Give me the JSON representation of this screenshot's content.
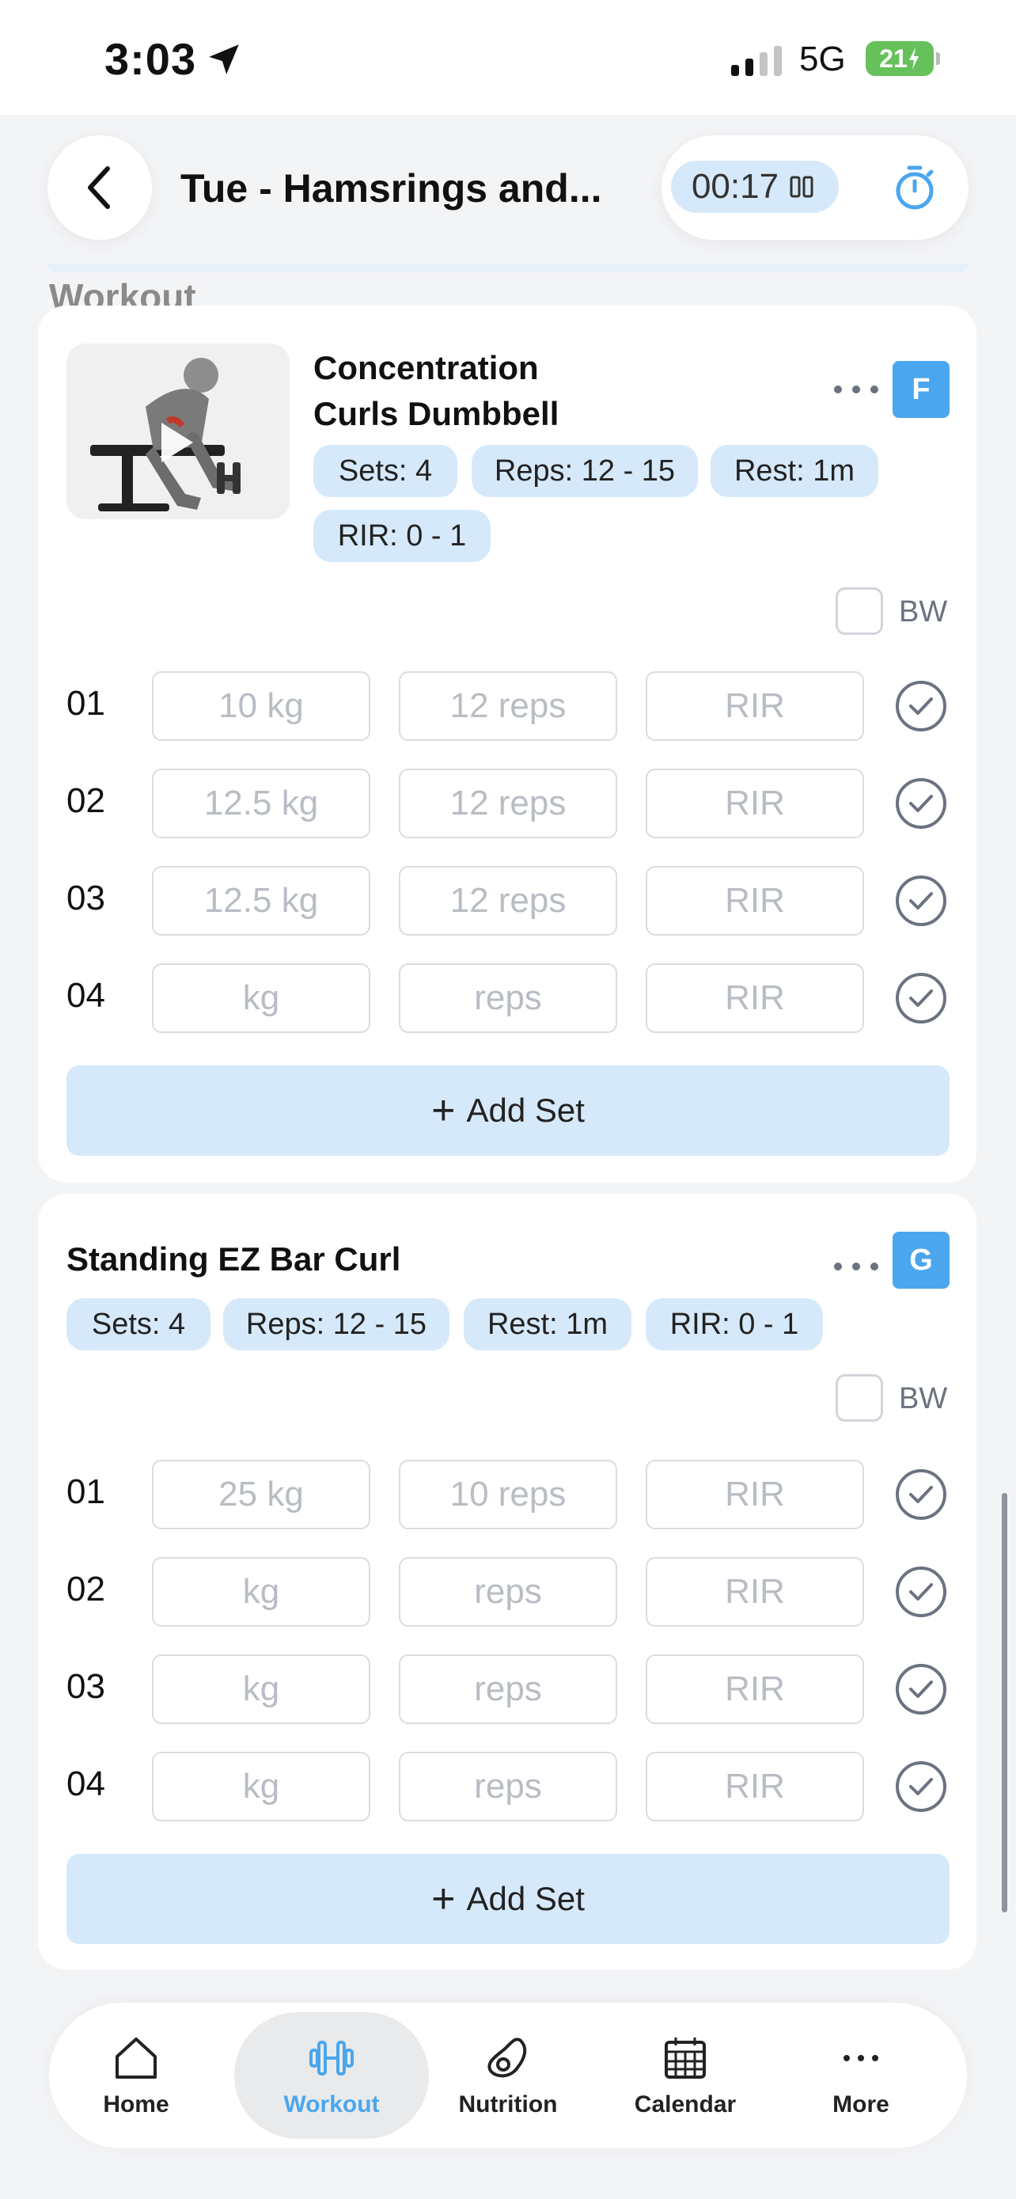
{
  "status": {
    "time": "3:03",
    "network": "5G",
    "battery": "21"
  },
  "header": {
    "title": "Tue - Hamsrings and...",
    "timer": "00:17"
  },
  "section_label": "Workout",
  "exercises": [
    {
      "name": "Concentration Curls Dumbbell",
      "badge": "F",
      "chips": [
        "Sets: 4",
        "Reps: 12 - 15",
        "Rest: 1m",
        "RIR: 0 - 1"
      ],
      "bw_label": "BW",
      "sets": [
        {
          "num": "01",
          "weight": "10 kg",
          "reps": "12 reps",
          "rir": "RIR"
        },
        {
          "num": "02",
          "weight": "12.5 kg",
          "reps": "12 reps",
          "rir": "RIR"
        },
        {
          "num": "03",
          "weight": "12.5 kg",
          "reps": "12 reps",
          "rir": "RIR"
        },
        {
          "num": "04",
          "weight": "kg",
          "reps": "reps",
          "rir": "RIR"
        }
      ],
      "add_set_label": "Add Set"
    },
    {
      "name": "Standing EZ Bar Curl",
      "badge": "G",
      "chips": [
        "Sets: 4",
        "Reps: 12 - 15",
        "Rest: 1m",
        "RIR: 0 - 1"
      ],
      "bw_label": "BW",
      "sets": [
        {
          "num": "01",
          "weight": "25 kg",
          "reps": "10 reps",
          "rir": "RIR"
        },
        {
          "num": "02",
          "weight": "kg",
          "reps": "reps",
          "rir": "RIR"
        },
        {
          "num": "03",
          "weight": "kg",
          "reps": "reps",
          "rir": "RIR"
        },
        {
          "num": "04",
          "weight": "kg",
          "reps": "reps",
          "rir": "RIR"
        }
      ],
      "add_set_label": "Add Set"
    }
  ],
  "nav": {
    "items": [
      {
        "label": "Home",
        "icon": "home-icon"
      },
      {
        "label": "Workout",
        "icon": "dumbbell-icon"
      },
      {
        "label": "Nutrition",
        "icon": "avocado-icon"
      },
      {
        "label": "Calendar",
        "icon": "calendar-icon"
      },
      {
        "label": "More",
        "icon": "more-icon"
      }
    ],
    "active": "Workout"
  },
  "colors": {
    "accent": "#4aa6ee",
    "chip": "#d6e9fa",
    "battery": "#66c15a"
  }
}
